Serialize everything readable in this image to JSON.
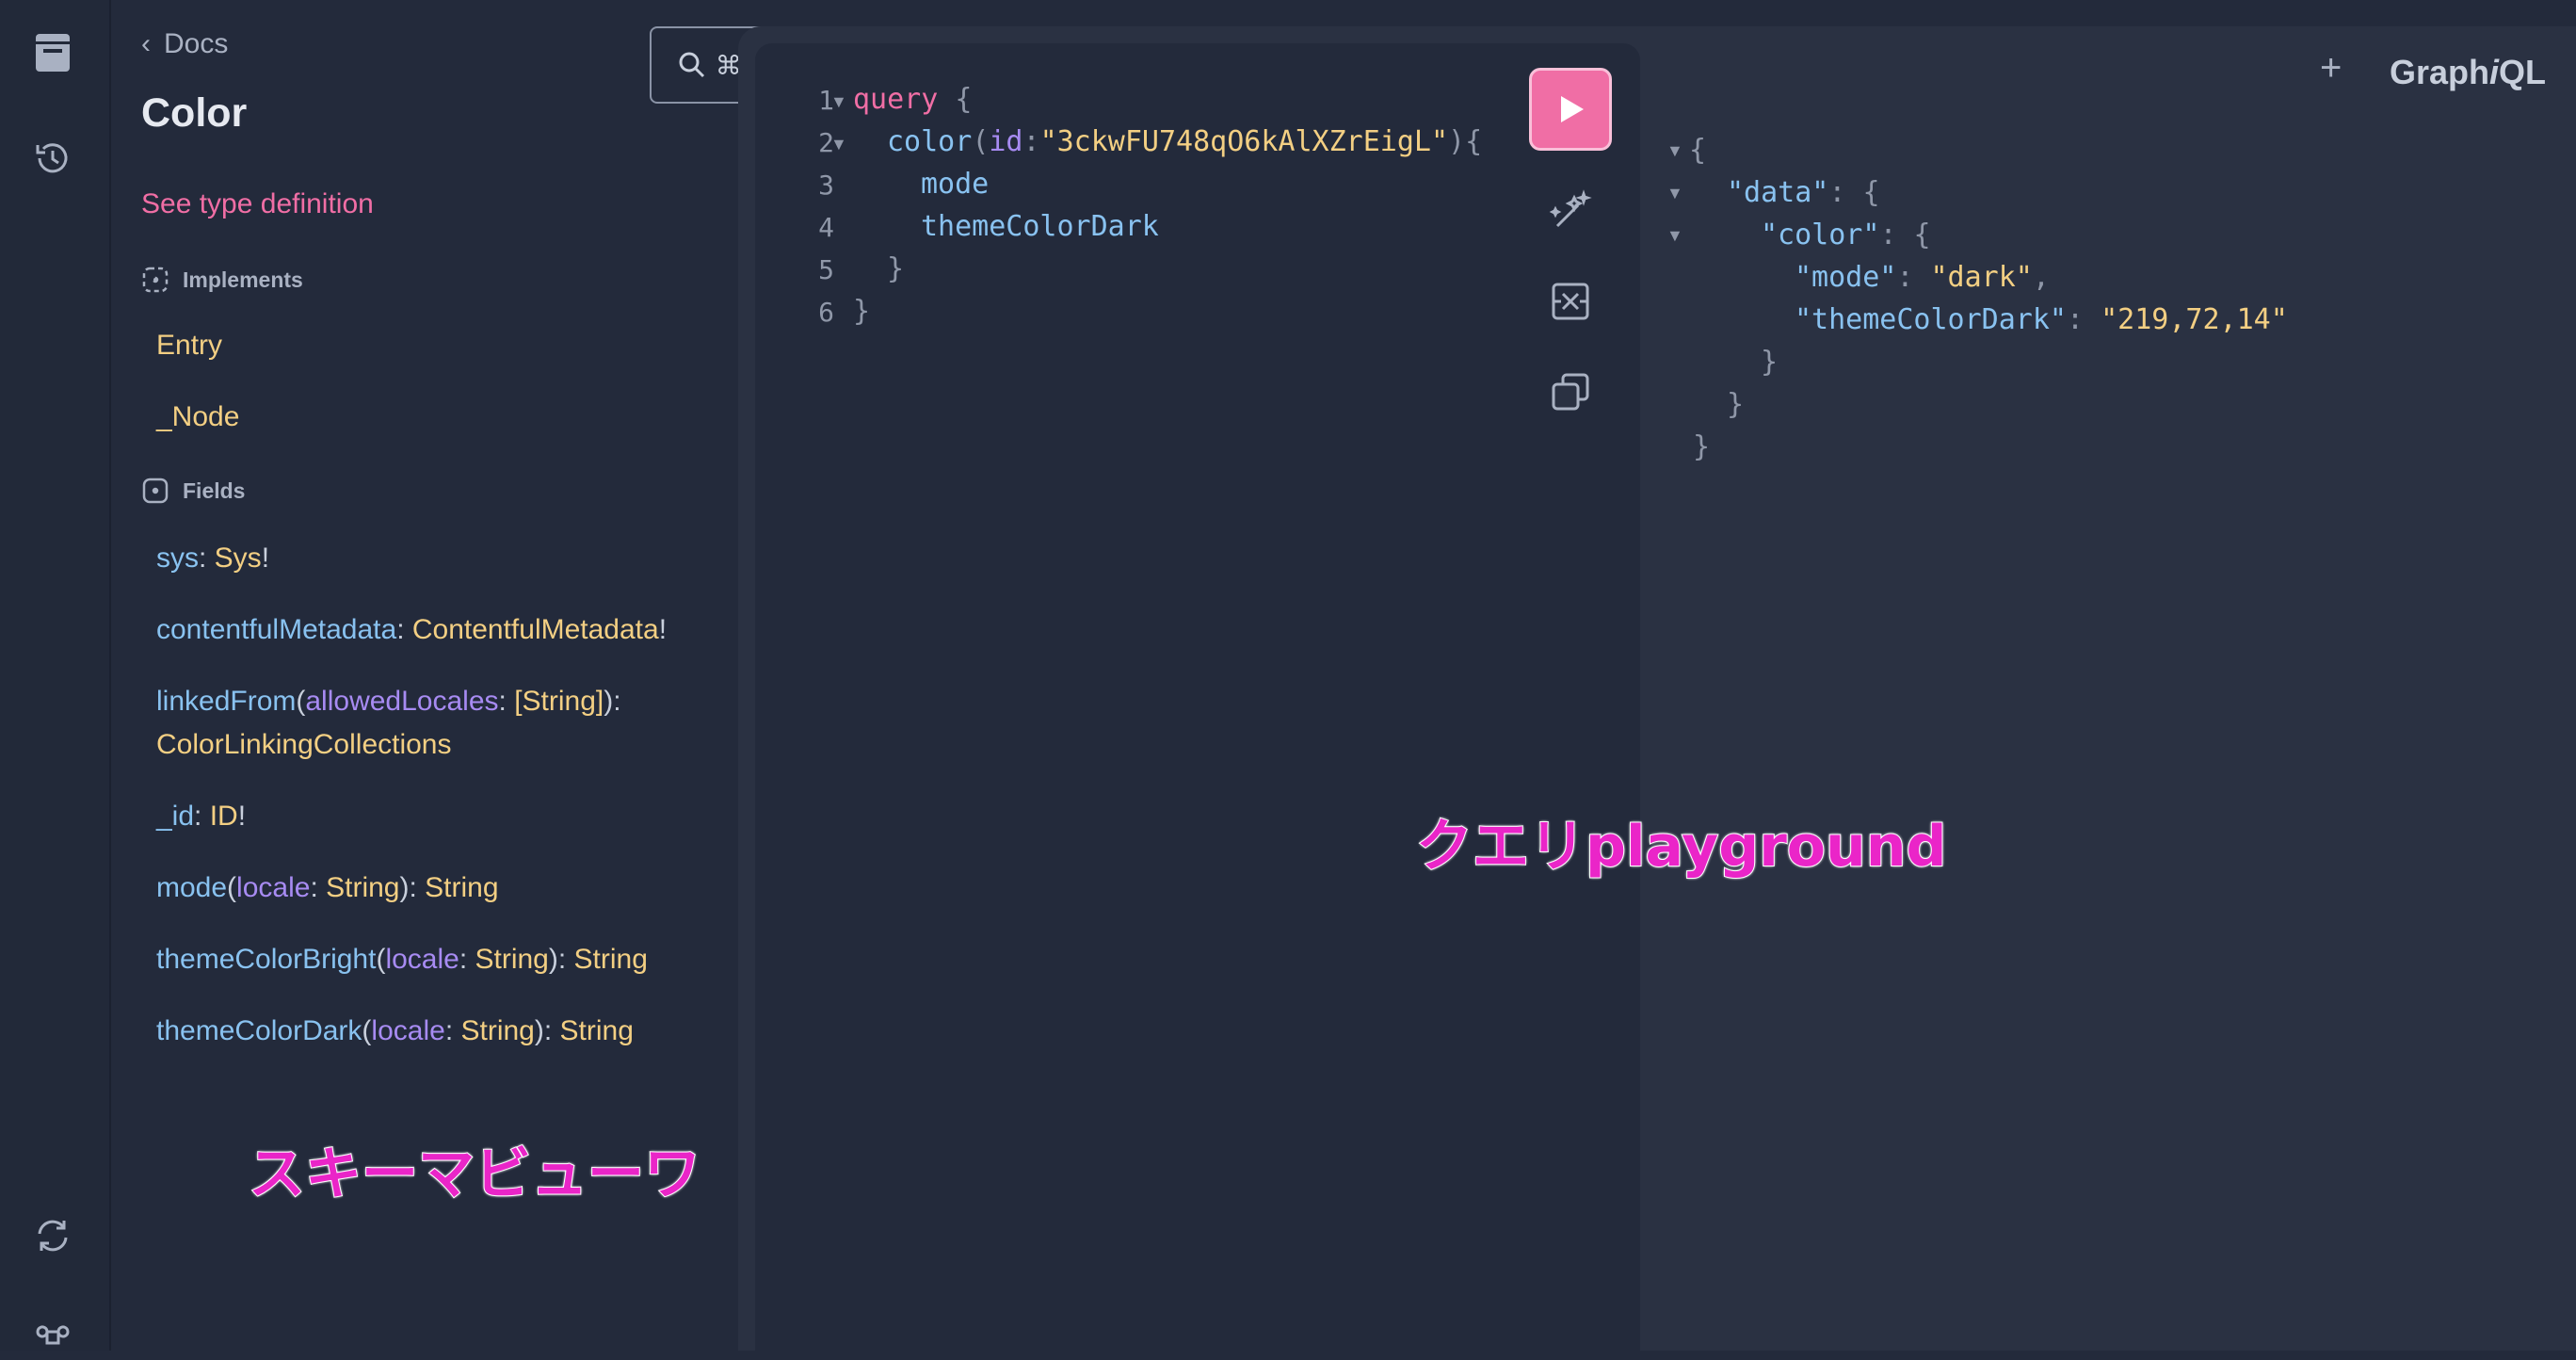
{
  "sidebar": {
    "items": [
      {
        "icon": "docs-icon"
      },
      {
        "icon": "history-icon"
      },
      {
        "icon": "refresh-icon"
      },
      {
        "icon": "command-icon"
      }
    ]
  },
  "docs": {
    "back_label": "Docs",
    "title": "Color",
    "search_label": "⌘ K",
    "see_type_definition": "See type definition",
    "implements_label": "Implements",
    "implements": [
      "Entry",
      "_Node"
    ],
    "fields_label": "Fields",
    "fields": [
      {
        "name": "sys",
        "sep": ": ",
        "type": "Sys",
        "suffix": "!"
      },
      {
        "name": "contentfulMetadata",
        "sep": ": ",
        "type": "ContentfulMetadata",
        "suffix": "!"
      },
      {
        "name": "linkedFrom",
        "open": "(",
        "arg": "allowedLocales",
        "argsep": ": ",
        "argtype": "[String]",
        "close": "): ",
        "type": "ColorLinkingCollections"
      },
      {
        "name": "_id",
        "sep": ": ",
        "type": "ID",
        "suffix": "!"
      },
      {
        "name": "mode",
        "open": "(",
        "arg": "locale",
        "argsep": ": ",
        "argtype": "String",
        "close": "): ",
        "type": "String"
      },
      {
        "name": "themeColorBright",
        "open": "(",
        "arg": "locale",
        "argsep": ": ",
        "argtype": "String",
        "close": "): ",
        "type": "String"
      },
      {
        "name": "themeColorDark",
        "open": "(",
        "arg": "locale",
        "argsep": ": ",
        "argtype": "String",
        "close": "): ",
        "type": "String"
      }
    ]
  },
  "editor": {
    "line_numbers": [
      "1",
      "2",
      "3",
      "4",
      "5",
      "6"
    ],
    "query_keyword": "query",
    "open_brace": "{",
    "field_color": "color",
    "arg_id": "id",
    "colon": ":",
    "id_value": "\"3ckwFU748qO6kAlXZrEigL\"",
    "paren_open": "(",
    "paren_close_brace": "){",
    "field_mode": "mode",
    "field_theme": "themeColorDark",
    "close_brace": "}"
  },
  "result": {
    "open_brace": "{",
    "key_data": "\"data\"",
    "key_color": "\"color\"",
    "key_mode": "\"mode\"",
    "val_mode": "\"dark\"",
    "key_theme": "\"themeColorDark\"",
    "val_theme": "\"219,72,14\"",
    "colon_brace": ": {",
    "colon": ": ",
    "comma": ",",
    "close_brace": "}"
  },
  "header": {
    "plus": "+",
    "logo_prefix": "Graph",
    "logo_italic": "i",
    "logo_suffix": "QL"
  },
  "captions": {
    "query": "クエリplayground",
    "schema": "スキーマビューワ"
  },
  "colors": {
    "accent": "#f06ea5",
    "caption": "#ea25c8"
  }
}
